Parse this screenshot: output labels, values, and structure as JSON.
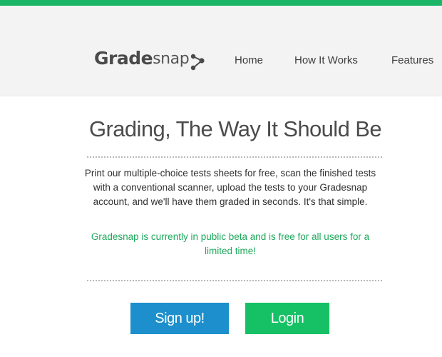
{
  "brand": {
    "logo_strong": "Grade",
    "logo_light": "snap",
    "accent_color": "#1bb567"
  },
  "nav": {
    "home": "Home",
    "how_it_works": "How It Works",
    "features": "Features"
  },
  "hero": {
    "headline": "Grading, The Way It Should Be",
    "description": "Print our multiple-choice tests sheets for free, scan the finished tests with a conventional scanner, upload the tests to your Gradesnap account, and we'll have them graded in seconds. It's that simple.",
    "beta_note": "Gradesnap is currently in public beta and is free for all users for a limited time!",
    "beta_color": "#1ea85b"
  },
  "actions": {
    "signup_label": "Sign up!",
    "signup_color": "#1c8fcc",
    "login_label": "Login",
    "login_color": "#16c165"
  }
}
